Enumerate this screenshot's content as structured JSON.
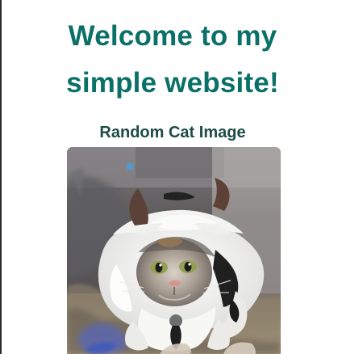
{
  "page": {
    "title_line_1": "Welcome to my",
    "title_line_2": "simple website!",
    "section_heading": "Random Cat Image"
  },
  "image": {
    "alt": "Random Cat Image",
    "subject": "cat-in-cow-costume"
  },
  "colors": {
    "title": "#0b7168",
    "heading": "#1d4b45",
    "background": "#ffffff"
  }
}
